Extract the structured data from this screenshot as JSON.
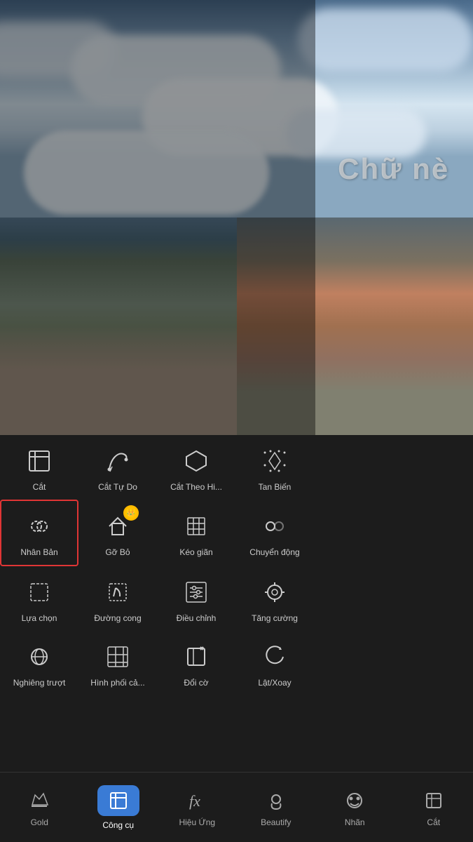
{
  "photo": {
    "watermark": "Chữ nè"
  },
  "tools": {
    "rows": [
      [
        {
          "id": "cat",
          "label": "Cắt",
          "active": false
        },
        {
          "id": "cat-tu-do",
          "label": "Cắt Tự Do",
          "active": false
        },
        {
          "id": "cat-theo-hinh",
          "label": "Cắt Theo Hi...",
          "active": false
        },
        {
          "id": "tan-bien",
          "label": "Tan Biến",
          "active": false
        }
      ],
      [
        {
          "id": "nhan-ban",
          "label": "Nhân Bản",
          "active": true
        },
        {
          "id": "go-bo",
          "label": "Gỡ Bỏ",
          "active": false,
          "premium": true
        },
        {
          "id": "keo-gian",
          "label": "Kéo giãn",
          "active": false
        },
        {
          "id": "chuyen-dong",
          "label": "Chuyển động",
          "active": false
        }
      ],
      [
        {
          "id": "lua-chon",
          "label": "Lựa chọn",
          "active": false
        },
        {
          "id": "duong-cong",
          "label": "Đường cong",
          "active": false
        },
        {
          "id": "dieu-chinh",
          "label": "Điều chỉnh",
          "active": false
        },
        {
          "id": "tang-cuong",
          "label": "Tăng cường",
          "active": false
        }
      ],
      [
        {
          "id": "nghieng-truot",
          "label": "Nghiêng trượt",
          "active": false
        },
        {
          "id": "hinh-phoi",
          "label": "Hình phối cả...",
          "active": false
        },
        {
          "id": "doi-co",
          "label": "Đổi cờ",
          "active": false
        },
        {
          "id": "lat-xoay",
          "label": "Lật/Xoay",
          "active": false
        }
      ]
    ]
  },
  "nav": {
    "items": [
      {
        "id": "gold",
        "label": "Gold",
        "active": false
      },
      {
        "id": "cong-cu",
        "label": "Công cụ",
        "active": true
      },
      {
        "id": "hieu-ung",
        "label": "Hiệu Ứng",
        "active": false
      },
      {
        "id": "beautify",
        "label": "Beautify",
        "active": false
      },
      {
        "id": "nhan",
        "label": "Nhãn",
        "active": false
      },
      {
        "id": "cat-nav",
        "label": "Cắt",
        "active": false
      }
    ]
  },
  "colors": {
    "active_border": "#e03535",
    "active_nav_bg": "#3a7bd5",
    "panel_bg": "#1c1c1c",
    "text_primary": "#cccccc",
    "text_white": "#ffffff"
  }
}
